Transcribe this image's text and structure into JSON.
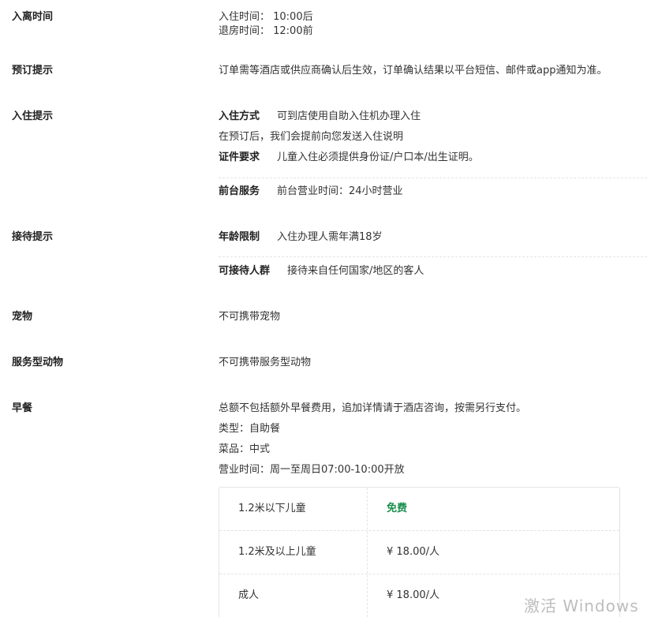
{
  "checkin_out": {
    "label": "入离时间",
    "checkin": "入住时间： 10:00后",
    "checkout": "退房时间： 12:00前"
  },
  "booking_tip": {
    "label": "预订提示",
    "text": "订单需等酒店或供应商确认后生效，订单确认结果以平台短信、邮件或app通知为准。"
  },
  "checkin_tip": {
    "label": "入住提示",
    "method_key": "入住方式",
    "method_value": "可到店使用自助入住机办理入住",
    "note": "在预订后，我们会提前向您发送入住说明",
    "id_key": "证件要求",
    "id_value": "儿童入住必须提供身份证/户口本/出生证明。",
    "front_key": "前台服务",
    "front_value": "前台营业时间：24小时营业"
  },
  "reception_tip": {
    "label": "接待提示",
    "age_key": "年龄限制",
    "age_value": "入住办理人需年满18岁",
    "guests_key": "可接待人群",
    "guests_value": "接待来自任何国家/地区的客人"
  },
  "pets": {
    "label": "宠物",
    "text": "不可携带宠物"
  },
  "service_animals": {
    "label": "服务型动物",
    "text": "不可携带服务型动物"
  },
  "breakfast": {
    "label": "早餐",
    "note": "总额不包括额外早餐费用，追加详情请于酒店咨询，按需另行支付。",
    "type": "类型：自助餐",
    "cuisine": "菜品：中式",
    "hours": "营业时间：周一至周日07:00-10:00开放",
    "prices": [
      {
        "who": "1.2米以下儿童",
        "price": "免费"
      },
      {
        "who": "1.2米及以上儿童",
        "price": "¥  18.00/人"
      },
      {
        "who": "成人",
        "price": "¥  18.00/人"
      }
    ]
  },
  "watermark": "激活 Windows",
  "colors": {
    "free": "#1a8f4e",
    "divider": "#e2e2e2"
  }
}
